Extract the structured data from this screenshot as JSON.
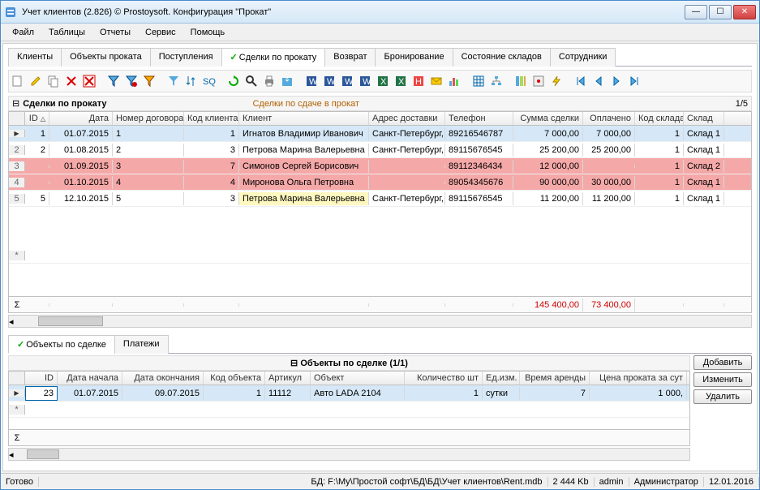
{
  "title": "Учет клиентов (2.826) © Prostoysoft. Конфигурация \"Прокат\"",
  "menu": [
    "Файл",
    "Таблицы",
    "Отчеты",
    "Сервис",
    "Помощь"
  ],
  "main_tabs": [
    "Клиенты",
    "Объекты проката",
    "Поступления",
    "Сделки по прокату",
    "Возврат",
    "Бронирование",
    "Состояние складов",
    "Сотрудники"
  ],
  "active_tab": 3,
  "section": {
    "title": "Сделки по прокату",
    "subtitle": "Сделки по сдаче в прокат",
    "pager": "1/5"
  },
  "grid": {
    "headers": [
      "ID",
      "Дата",
      "Номер договора",
      "Код клиента",
      "Клиент",
      "Адрес доставки",
      "Телефон",
      "Сумма сделки",
      "Оплачено",
      "Код склада",
      "Склад"
    ],
    "rows": [
      {
        "sel": true,
        "cur": true,
        "n": 1,
        "id": "1",
        "date": "01.07.2015",
        "num": "1",
        "kod": "1",
        "client": "Игнатов Владимир Иванович",
        "addr": "Санкт-Петербург, п",
        "tel": "89216546787",
        "sum": "7 000,00",
        "paid": "7 000,00",
        "skl": "1",
        "skln": "Склад 1"
      },
      {
        "n": 2,
        "id": "2",
        "date": "01.08.2015",
        "num": "2",
        "kod": "3",
        "client": "Петрова Марина Валерьевна",
        "addr": "Санкт-Петербург, М",
        "tel": "89115676545",
        "sum": "25 200,00",
        "paid": "25 200,00",
        "skl": "1",
        "skln": "Склад 1"
      },
      {
        "red": true,
        "n": 3,
        "id": "",
        "date": "01.09.2015",
        "num": "3",
        "kod": "7",
        "client": "Симонов Сергей Борисович",
        "addr": "",
        "tel": "89112346434",
        "sum": "12 000,00",
        "paid": "",
        "skl": "1",
        "skln": "Склад 2"
      },
      {
        "red": true,
        "n": 4,
        "id": "",
        "date": "01.10.2015",
        "num": "4",
        "kod": "4",
        "client": "Миронова Ольга Петровна",
        "addr": "",
        "tel": "89054345676",
        "sum": "90 000,00",
        "paid": "30 000,00",
        "skl": "1",
        "skln": "Склад 1"
      },
      {
        "yellow": true,
        "n": 5,
        "id": "5",
        "date": "12.10.2015",
        "num": "5",
        "kod": "3",
        "client": "Петрова Марина Валерьевна",
        "addr": "Санкт-Петербург, М",
        "tel": "89115676545",
        "sum": "11 200,00",
        "paid": "11 200,00",
        "skl": "1",
        "skln": "Склад 1"
      }
    ],
    "totals": {
      "sum": "145 400,00",
      "paid": "73 400,00"
    }
  },
  "sub_tabs": [
    "Объекты по сделке",
    "Платежи"
  ],
  "detail": {
    "title": "Объекты по сделке (1/1)",
    "headers": [
      "ID",
      "Дата начала",
      "Дата окончания",
      "Код объекта",
      "Артикул",
      "Объект",
      "Количество шт",
      "Ед.изм.",
      "Время аренды",
      "Цена проката за сут"
    ],
    "rows": [
      {
        "sel": true,
        "cur": true,
        "id": "23",
        "d1": "01.07.2015",
        "d2": "09.07.2015",
        "ko": "1",
        "art": "11112",
        "obj": "Авто LADA 2104",
        "qty": "1",
        "ed": "сутки",
        "tm": "7",
        "pr": "1 000,"
      }
    ]
  },
  "buttons": {
    "add": "Добавить",
    "edit": "Изменить",
    "del": "Удалить"
  },
  "status": {
    "ready": "Готово",
    "db_label": "БД:",
    "db": "F:\\My\\Простой софт\\БД\\БД\\Учет клиентов\\Rent.mdb",
    "size": "2 444 Kb",
    "user": "admin",
    "role": "Администратор",
    "date": "12.01.2016"
  }
}
